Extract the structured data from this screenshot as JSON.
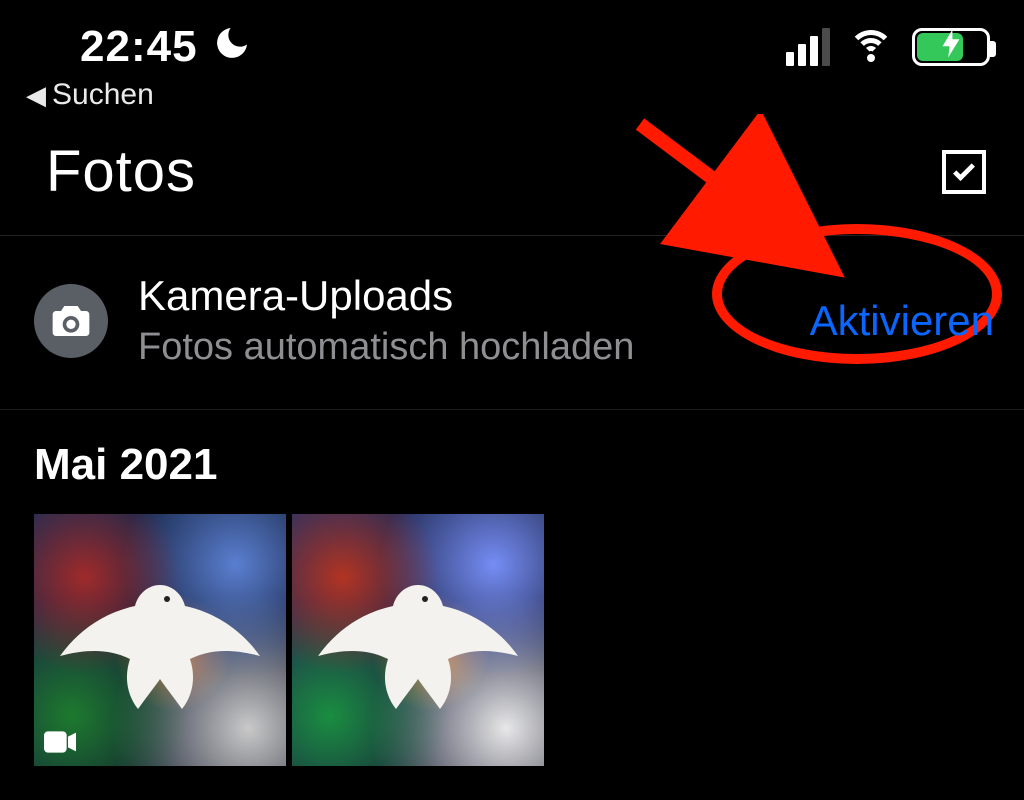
{
  "status": {
    "time": "22:45",
    "dnd_icon": "moon-icon"
  },
  "back": {
    "label": "Suchen"
  },
  "header": {
    "title": "Fotos"
  },
  "camera_upload": {
    "title": "Kamera-Uploads",
    "subtitle": "Fotos automatisch hochladen",
    "action_label": "Aktivieren"
  },
  "sections": [
    {
      "title": "Mai 2021"
    }
  ],
  "colors": {
    "accent_link": "#0b66ff",
    "annotation": "#ff1a00",
    "battery_fill": "#34c759"
  }
}
